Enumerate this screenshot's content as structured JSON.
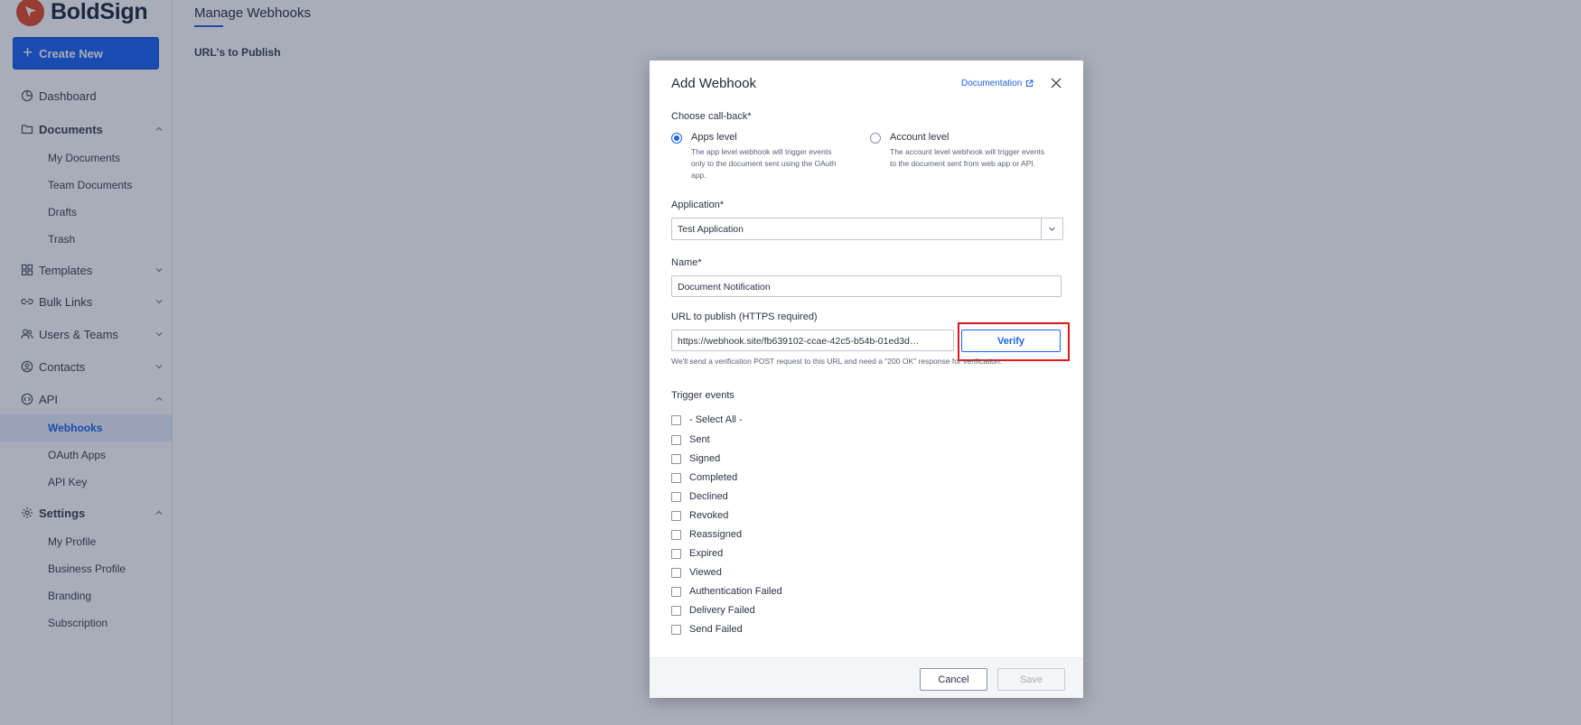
{
  "app": {
    "brand": "BoldSign"
  },
  "sidebar": {
    "create_label": "Create New",
    "dashboard": "Dashboard",
    "documents": "Documents",
    "documents_sub": [
      "My Documents",
      "Team Documents",
      "Drafts",
      "Trash"
    ],
    "templates": "Templates",
    "bulk_links": "Bulk Links",
    "users_teams": "Users & Teams",
    "contacts": "Contacts",
    "api": "API",
    "api_sub": [
      "Webhooks",
      "OAuth Apps",
      "API Key"
    ],
    "settings": "Settings",
    "settings_sub": [
      "My Profile",
      "Business Profile",
      "Branding",
      "Subscription"
    ]
  },
  "main": {
    "title": "Manage Webhooks",
    "urls_label": "URL's to Publish"
  },
  "modal": {
    "title": "Add Webhook",
    "documentation": "Documentation",
    "callback_label": "Choose call-back*",
    "apps_level": {
      "title": "Apps level",
      "desc": "The app level webhook will trigger events only to the document sent using the OAuth app.",
      "selected": true
    },
    "account_level": {
      "title": "Account level",
      "desc": "The account level webhook will trigger events to the document sent from web app or API.",
      "selected": false
    },
    "application_label": "Application*",
    "application_value": "Test Application",
    "name_label": "Name*",
    "name_value": "Document Notification",
    "url_label": "URL to publish (HTTPS required)",
    "url_value": "https://webhook.site/fb639102-ccae-42c5-b54b-01ed3d…",
    "verify_label": "Verify",
    "url_hint": "We'll send a verification POST request to this URL and need a \"200 OK\" response for verification.",
    "trigger_label": "Trigger events",
    "events": [
      "- Select All -",
      "Sent",
      "Signed",
      "Completed",
      "Declined",
      "Revoked",
      "Reassigned",
      "Expired",
      "Viewed",
      "Authentication Failed",
      "Delivery Failed",
      "Send Failed"
    ],
    "cancel_label": "Cancel",
    "save_label": "Save"
  },
  "colors": {
    "accent": "#1a62f0",
    "brand": "#e24a28",
    "highlight": "#e0161d"
  }
}
